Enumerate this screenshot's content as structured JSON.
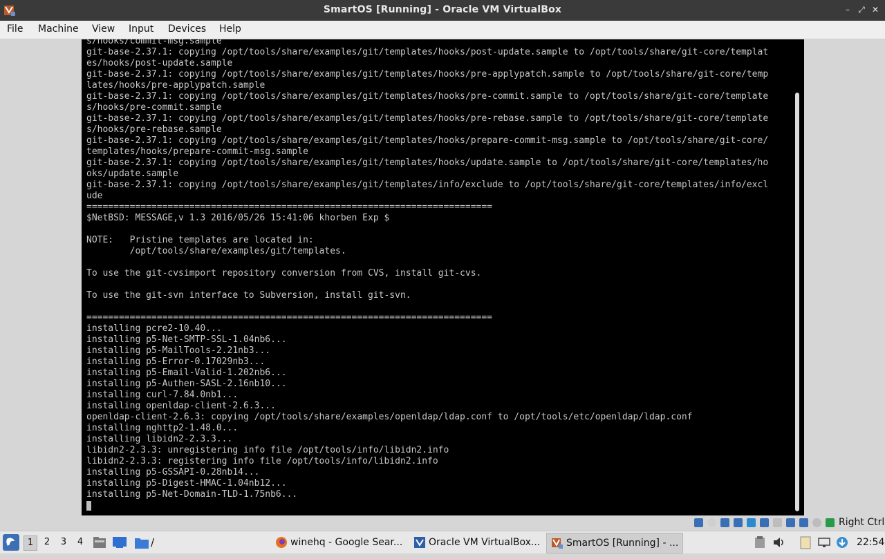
{
  "window": {
    "title": "SmartOS [Running] - Oracle VM VirtualBox",
    "controls": {
      "minimize": "–",
      "maximize": "⤢",
      "close": "✕"
    }
  },
  "menubar": {
    "items": [
      "File",
      "Machine",
      "View",
      "Input",
      "Devices",
      "Help"
    ]
  },
  "console": {
    "lines": [
      "s/hooks/commit-msg.sample",
      "git-base-2.37.1: copying /opt/tools/share/examples/git/templates/hooks/post-update.sample to /opt/tools/share/git-core/templat",
      "es/hooks/post-update.sample",
      "git-base-2.37.1: copying /opt/tools/share/examples/git/templates/hooks/pre-applypatch.sample to /opt/tools/share/git-core/temp",
      "lates/hooks/pre-applypatch.sample",
      "git-base-2.37.1: copying /opt/tools/share/examples/git/templates/hooks/pre-commit.sample to /opt/tools/share/git-core/template",
      "s/hooks/pre-commit.sample",
      "git-base-2.37.1: copying /opt/tools/share/examples/git/templates/hooks/pre-rebase.sample to /opt/tools/share/git-core/template",
      "s/hooks/pre-rebase.sample",
      "git-base-2.37.1: copying /opt/tools/share/examples/git/templates/hooks/prepare-commit-msg.sample to /opt/tools/share/git-core/",
      "templates/hooks/prepare-commit-msg.sample",
      "git-base-2.37.1: copying /opt/tools/share/examples/git/templates/hooks/update.sample to /opt/tools/share/git-core/templates/ho",
      "oks/update.sample",
      "git-base-2.37.1: copying /opt/tools/share/examples/git/templates/info/exclude to /opt/tools/share/git-core/templates/info/excl",
      "ude",
      "===========================================================================",
      "$NetBSD: MESSAGE,v 1.3 2016/05/26 15:41:06 khorben Exp $",
      "",
      "NOTE:   Pristine templates are located in:",
      "        /opt/tools/share/examples/git/templates.",
      "",
      "To use the git-cvsimport repository conversion from CVS, install git-cvs.",
      "",
      "To use the git-svn interface to Subversion, install git-svn.",
      "",
      "===========================================================================",
      "installing pcre2-10.40...",
      "installing p5-Net-SMTP-SSL-1.04nb6...",
      "installing p5-MailTools-2.21nb3...",
      "installing p5-Error-0.17029nb3...",
      "installing p5-Email-Valid-1.202nb6...",
      "installing p5-Authen-SASL-2.16nb10...",
      "installing curl-7.84.0nb1...",
      "installing openldap-client-2.6.3...",
      "openldap-client-2.6.3: copying /opt/tools/share/examples/openldap/ldap.conf to /opt/tools/etc/openldap/ldap.conf",
      "installing nghttp2-1.48.0...",
      "installing libidn2-2.3.3...",
      "libidn2-2.3.3: unregistering info file /opt/tools/info/libidn2.info",
      "libidn2-2.3.3: registering info file /opt/tools/info/libidn2.info",
      "installing p5-GSSAPI-0.28nb14...",
      "installing p5-Digest-HMAC-1.04nb12...",
      "installing p5-Net-Domain-TLD-1.75nb6..."
    ]
  },
  "statusbar": {
    "icons": [
      "hard-disk-icon",
      "optical-drive-icon",
      "audio-icon",
      "network-icon",
      "usb-icon",
      "shared-folders-icon",
      "display-icon",
      "recording-icon",
      "cpu-icon",
      "mouse-integration-icon",
      "keyboard-capture-icon"
    ],
    "host_key": "Right Ctrl"
  },
  "taskbar": {
    "workspaces": [
      "1",
      "2",
      "3",
      "4"
    ],
    "launcher_path": "/",
    "tasks": [
      {
        "label": "winehq - Google Sear...",
        "active": false
      },
      {
        "label": "Oracle VM VirtualBox...",
        "active": false
      },
      {
        "label": "SmartOS [Running] - ...",
        "active": true
      }
    ],
    "clock": "22:54"
  }
}
